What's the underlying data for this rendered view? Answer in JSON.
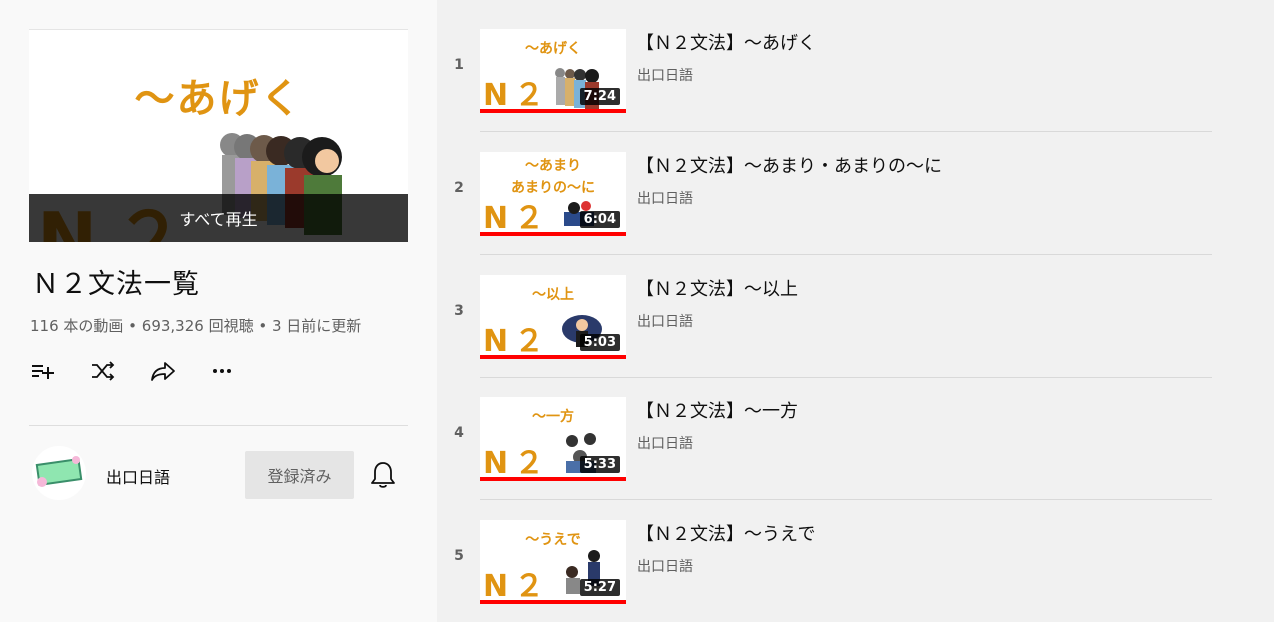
{
  "playlist": {
    "hero_thumb_text": "～あげく",
    "hero_thumb_n2": "N２",
    "play_all_label": "すべて再生",
    "title": "Ｎ２文法一覧",
    "meta": "116 本の動画 • 693,326 回視聴 • 3 日前に更新"
  },
  "actions": [
    "save-to-playlist-icon",
    "shuffle-icon",
    "share-icon",
    "more-icon"
  ],
  "channel": {
    "name": "出口日語",
    "subscribe_label": "登録済み"
  },
  "videos": [
    {
      "index": "1",
      "thumb_text": "～あげく",
      "thumb_n2": "N２",
      "duration": "7:24",
      "title": "【Ｎ２文法】～あげく",
      "channel": "出口日語"
    },
    {
      "index": "2",
      "thumb_text": "～あまり\nあまりの～に",
      "thumb_n2": "N２",
      "duration": "6:04",
      "title": "【Ｎ２文法】～あまり・あまりの～に",
      "channel": "出口日語"
    },
    {
      "index": "3",
      "thumb_text": "～以上",
      "thumb_n2": "N２",
      "duration": "5:03",
      "title": "【Ｎ２文法】～以上",
      "channel": "出口日語"
    },
    {
      "index": "4",
      "thumb_text": "～一方",
      "thumb_n2": "N２",
      "duration": "5:33",
      "title": "【Ｎ２文法】～一方",
      "channel": "出口日語"
    },
    {
      "index": "5",
      "thumb_text": "～うえで",
      "thumb_n2": "N２",
      "duration": "5:27",
      "title": "【Ｎ２文法】～うえで",
      "channel": "出口日語"
    }
  ],
  "colors": {
    "accent": "#e09412",
    "progress": "#ff0000"
  }
}
